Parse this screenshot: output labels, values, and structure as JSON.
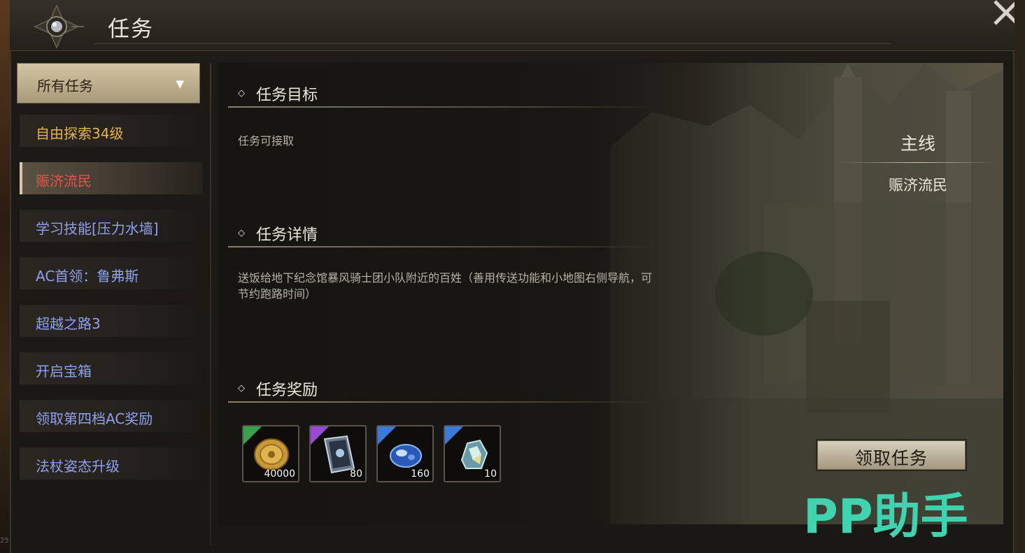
{
  "header": {
    "title": "任务"
  },
  "sidebar": {
    "filter_label": "所有任务",
    "items": [
      {
        "label": "自由探索34级",
        "color": "#e8b448"
      },
      {
        "label": "赈济流民",
        "color": "#e2544a",
        "selected": true
      },
      {
        "label": "学习技能[压力水墙]",
        "color": "#8fa0ec"
      },
      {
        "label": "AC首领：鲁弗斯",
        "color": "#8fa0ec"
      },
      {
        "label": "超越之路3",
        "color": "#8fa0ec"
      },
      {
        "label": "开启宝箱",
        "color": "#8fa0ec"
      },
      {
        "label": "领取第四档AC奖励",
        "color": "#8fa0ec"
      },
      {
        "label": "法杖姿态升级",
        "color": "#8fa0ec"
      }
    ]
  },
  "main": {
    "objective_title": "任务目标",
    "objective_text": "任务可接取",
    "details_title": "任务详情",
    "details_text_line1": "送饭给地下纪念馆暴风骑士团小队附近的百姓（善用传送功能和小地图右侧导航，可",
    "details_text_line2": "节约跑路时间）",
    "rewards_title": "任务奖励",
    "rewards": [
      {
        "icon": "gold-coin-icon",
        "quantity": "40000",
        "rarity_color": "#3aa14a"
      },
      {
        "icon": "scroll-card-icon",
        "quantity": "80",
        "rarity_color": "#9a4ad0"
      },
      {
        "icon": "blue-gem-icon",
        "quantity": "160",
        "rarity_color": "#3a7ad8"
      },
      {
        "icon": "crystal-shard-icon",
        "quantity": "10",
        "rarity_color": "#3a7ad8"
      }
    ],
    "questline_type": "主线",
    "questline_name": "赈济流民",
    "accept_label": "领取任务"
  },
  "watermark": "PP助手",
  "corner_number": "25"
}
